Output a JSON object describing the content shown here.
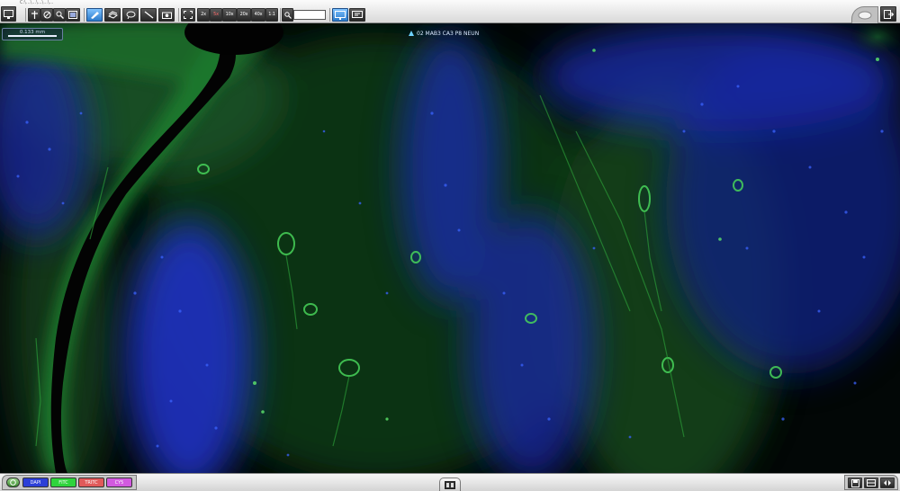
{
  "window": {
    "title_text": "C:\\...\\...\\...\\...\\..."
  },
  "toolbar": {
    "zoom_value": "2x",
    "zoom_field": "",
    "buttons": [
      {
        "name": "app-menu-button",
        "icon": "monitor-icon"
      },
      {
        "name": "pan-tool-button",
        "icon": "hand-icon"
      },
      {
        "name": "measure-tool-button",
        "icon": "ruler-icon"
      },
      {
        "name": "circle-tool-button",
        "icon": "circle-icon"
      },
      {
        "name": "zoom-tool-button",
        "icon": "magnifier-icon"
      },
      {
        "name": "overview-button",
        "icon": "image-icon"
      },
      {
        "name": "annotation-button",
        "icon": "pen-icon"
      },
      {
        "name": "layers-button",
        "icon": "layers-icon"
      },
      {
        "name": "lasso-button",
        "icon": "lasso-icon"
      },
      {
        "name": "line-button",
        "icon": "line-icon"
      },
      {
        "name": "snapshot-button",
        "icon": "camera-icon"
      },
      {
        "name": "fit-to-screen-button",
        "icon": "expand-icon"
      },
      {
        "name": "zoom-2x-button",
        "icon": "zoom-preset-icon"
      },
      {
        "name": "zoom-5x-button",
        "icon": "zoom-preset-icon"
      },
      {
        "name": "zoom-10x-button",
        "icon": "zoom-preset-icon"
      },
      {
        "name": "zoom-20x-button",
        "icon": "zoom-preset-icon"
      },
      {
        "name": "zoom-40x-button",
        "icon": "zoom-preset-icon"
      },
      {
        "name": "zoom-1to1-button",
        "icon": "zoom-preset-icon"
      },
      {
        "name": "zoom-input-button",
        "icon": "magnifier-icon"
      },
      {
        "name": "screenshot-button",
        "icon": "monitor-icon"
      },
      {
        "name": "settings-button",
        "icon": "sliders-icon"
      }
    ]
  },
  "scale_bar": {
    "label": "0.133 mm"
  },
  "image_label": {
    "text": "02 MAB3 CA3 P8 NEUN"
  },
  "channels": [
    {
      "label": "DAPI",
      "color": "#2c3fd8"
    },
    {
      "label": "FITC",
      "color": "#2fd43c"
    },
    {
      "label": "TRITC",
      "color": "#e05a5a"
    },
    {
      "label": "CY5",
      "color": "#d25adf"
    }
  ],
  "colors": {
    "nuclei_blue": "#1e3bd6",
    "neuron_green": "#2fbf3a",
    "background": "#000000",
    "toolbar_active": "#2a79c9"
  }
}
